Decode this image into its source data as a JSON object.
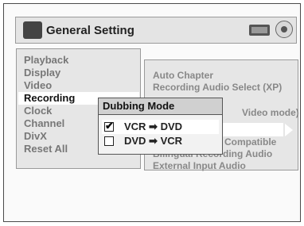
{
  "header": {
    "title": "General Setting"
  },
  "left_menu": {
    "items": [
      "Playback",
      "Display",
      "Video",
      "Recording",
      "Clock",
      "Channel",
      "DivX",
      "Reset All"
    ],
    "active_index": 3
  },
  "right_menu": {
    "items_visible": [
      "Auto Chapter",
      "Recording Audio Select (XP)",
      "Video mode)",
      "e",
      "Compatible",
      "Bilingual Recording Audio",
      "External Input Audio"
    ]
  },
  "popup": {
    "title": "Dubbing Mode",
    "options": [
      {
        "label": "VCR ➡ DVD",
        "checked": true,
        "check": "✔"
      },
      {
        "label": "DVD ➡ VCR",
        "checked": false,
        "check": ""
      }
    ]
  }
}
